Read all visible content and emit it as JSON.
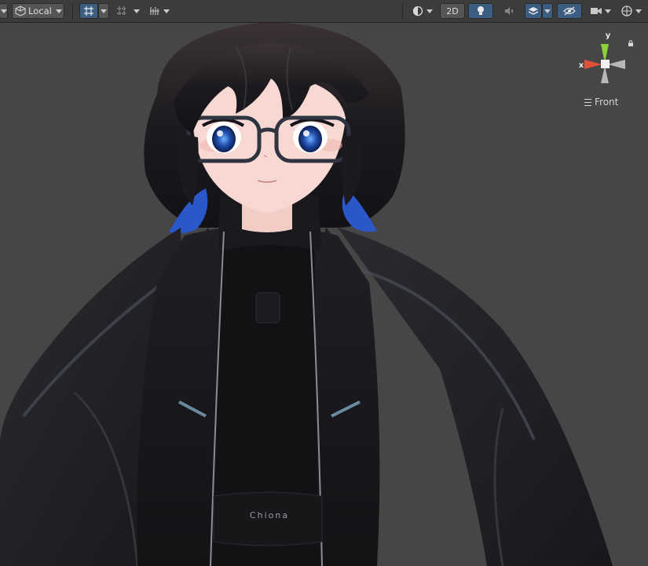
{
  "toolbar": {
    "pivot_rotation_label": "Local",
    "toggle_2d_label": "2D",
    "icons": [
      "pivot-icon",
      "grid-snap-icon",
      "grid-icon",
      "increment-snap-icon",
      "shading-icon",
      "2d-toggle",
      "lighting-icon",
      "audio-icon",
      "effects-icon",
      "hidden-objects-icon",
      "camera-icon",
      "gizmos-icon"
    ]
  },
  "gizmo": {
    "x_label": "x",
    "y_label": "y",
    "view_label": "Front",
    "colors": {
      "x": "#e0523a",
      "y": "#8ed13a",
      "center": "#f0f0f0",
      "neutral": "#b8b8b8"
    }
  },
  "scene": {
    "background": "#464646",
    "subject": "3D avatar character model",
    "jacket_logo_text": "Chiona",
    "colors": {
      "hair": "#1a1a20",
      "hair_highlight": "#2a58c8",
      "skin": "#f7d8d2",
      "eyes": "#1e4aa8",
      "jacket": "#16161a",
      "jacket_trim": "#6a8aa0"
    }
  }
}
